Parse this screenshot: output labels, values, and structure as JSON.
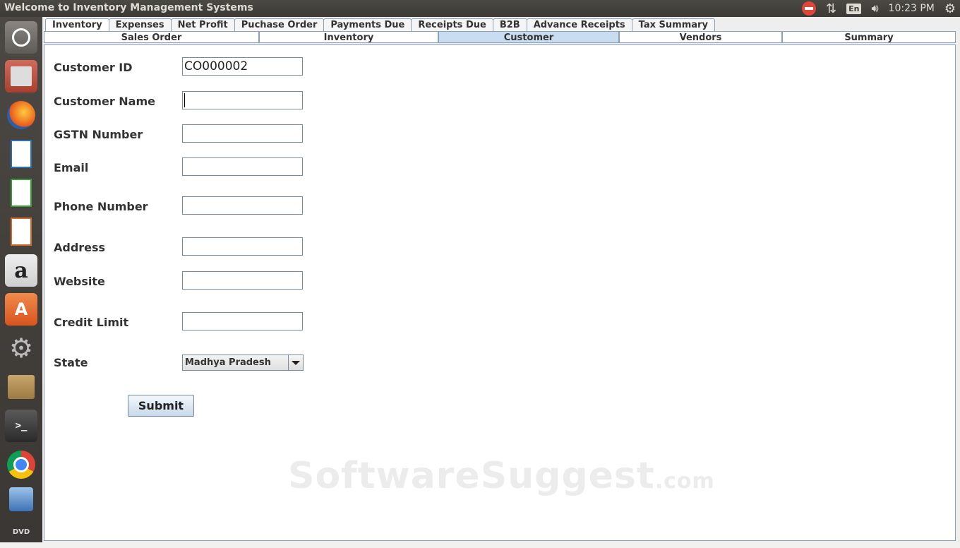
{
  "window": {
    "title": "Welcome to Inventory Management Systems"
  },
  "tray": {
    "language": "En",
    "time": "10:23 PM"
  },
  "launcher": {
    "items": [
      "ubuntu-dash",
      "files",
      "firefox",
      "writer",
      "calc",
      "impress",
      "amazon",
      "software-center",
      "system-settings",
      "archive",
      "terminal",
      "chrome",
      "virtualbox",
      "dvd"
    ]
  },
  "tabs_top": [
    "Inventory",
    "Expenses",
    "Net Profit",
    "Puchase Order",
    "Payments Due",
    "Receipts Due",
    "B2B",
    "Advance Receipts",
    "Tax Summary"
  ],
  "tabs_sub": [
    "Sales Order",
    "Inventory",
    "Customer",
    "Vendors",
    "Summary"
  ],
  "form": {
    "customer_id_label": "Customer ID",
    "customer_id_value": "CO000002",
    "customer_name_label": "Customer Name",
    "gstn_label": "GSTN Number",
    "email_label": "Email",
    "phone_label": "Phone Number",
    "address_label": "Address",
    "website_label": "Website",
    "credit_limit_label": "Credit Limit",
    "state_label": "State",
    "state_value": "Madhya Pradesh",
    "submit_label": "Submit"
  },
  "watermark": {
    "main": "SoftwareSuggest",
    "suffix": ".com"
  }
}
